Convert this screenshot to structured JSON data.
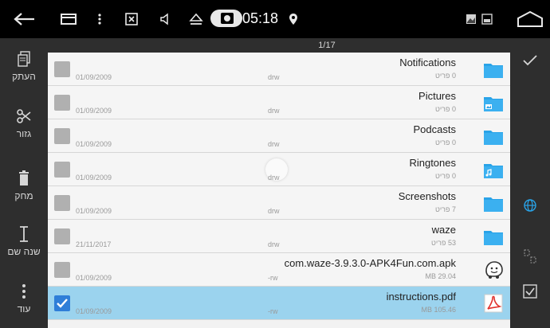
{
  "status_bar": {
    "time": "05:18",
    "icons": [
      "back-arrow-icon",
      "recents-icon",
      "more-vertical-icon",
      "close-box-icon",
      "volume-icon",
      "eject-icon",
      "camera-icon",
      "location-pin-icon",
      "picture-icon",
      "picture-icon",
      "home-icon"
    ]
  },
  "header": {
    "counter": "1/17"
  },
  "left_actions": [
    {
      "label": "העתק",
      "icon": "copy-icon"
    },
    {
      "label": "גזור",
      "icon": "scissors-icon"
    },
    {
      "label": "מחק",
      "icon": "trash-icon"
    },
    {
      "label": "שנה שם",
      "icon": "text-cursor-icon"
    },
    {
      "label": "עוד",
      "icon": "more-vertical-icon"
    }
  ],
  "right_actions": [
    "check-icon",
    "globe-icon",
    "select-area-icon",
    "select-all-icon"
  ],
  "files": [
    {
      "name": "Notifications",
      "meta": "0 פריט",
      "date": "01/09/2009",
      "perm": "drw",
      "type": "folder",
      "selected": false
    },
    {
      "name": "Pictures",
      "meta": "0 פריט",
      "date": "01/09/2009",
      "perm": "drw",
      "type": "folder-image",
      "selected": false
    },
    {
      "name": "Podcasts",
      "meta": "0 פריט",
      "date": "01/09/2009",
      "perm": "drw",
      "type": "folder",
      "selected": false
    },
    {
      "name": "Ringtones",
      "meta": "0 פריט",
      "date": "01/09/2009",
      "perm": "drw",
      "type": "folder-music",
      "selected": false
    },
    {
      "name": "Screenshots",
      "meta": "7 פריט",
      "date": "01/09/2009",
      "perm": "drw",
      "type": "folder",
      "selected": false
    },
    {
      "name": "waze",
      "meta": "53 פריט",
      "date": "21/11/2017",
      "perm": "drw",
      "type": "folder",
      "selected": false
    },
    {
      "name": "com.waze-3.9.3.0-APK4Fun.com.apk",
      "meta": "29.04 MB",
      "date": "01/09/2009",
      "perm": "-rw",
      "type": "apk",
      "selected": false
    },
    {
      "name": "instructions.pdf",
      "meta": "105.46 MB",
      "date": "01/09/2009",
      "perm": "-rw",
      "type": "pdf",
      "selected": true
    }
  ],
  "colors": {
    "folder": "#29a3e8",
    "selected_row": "#9bd3ee",
    "accent": "#2f7ed8"
  }
}
